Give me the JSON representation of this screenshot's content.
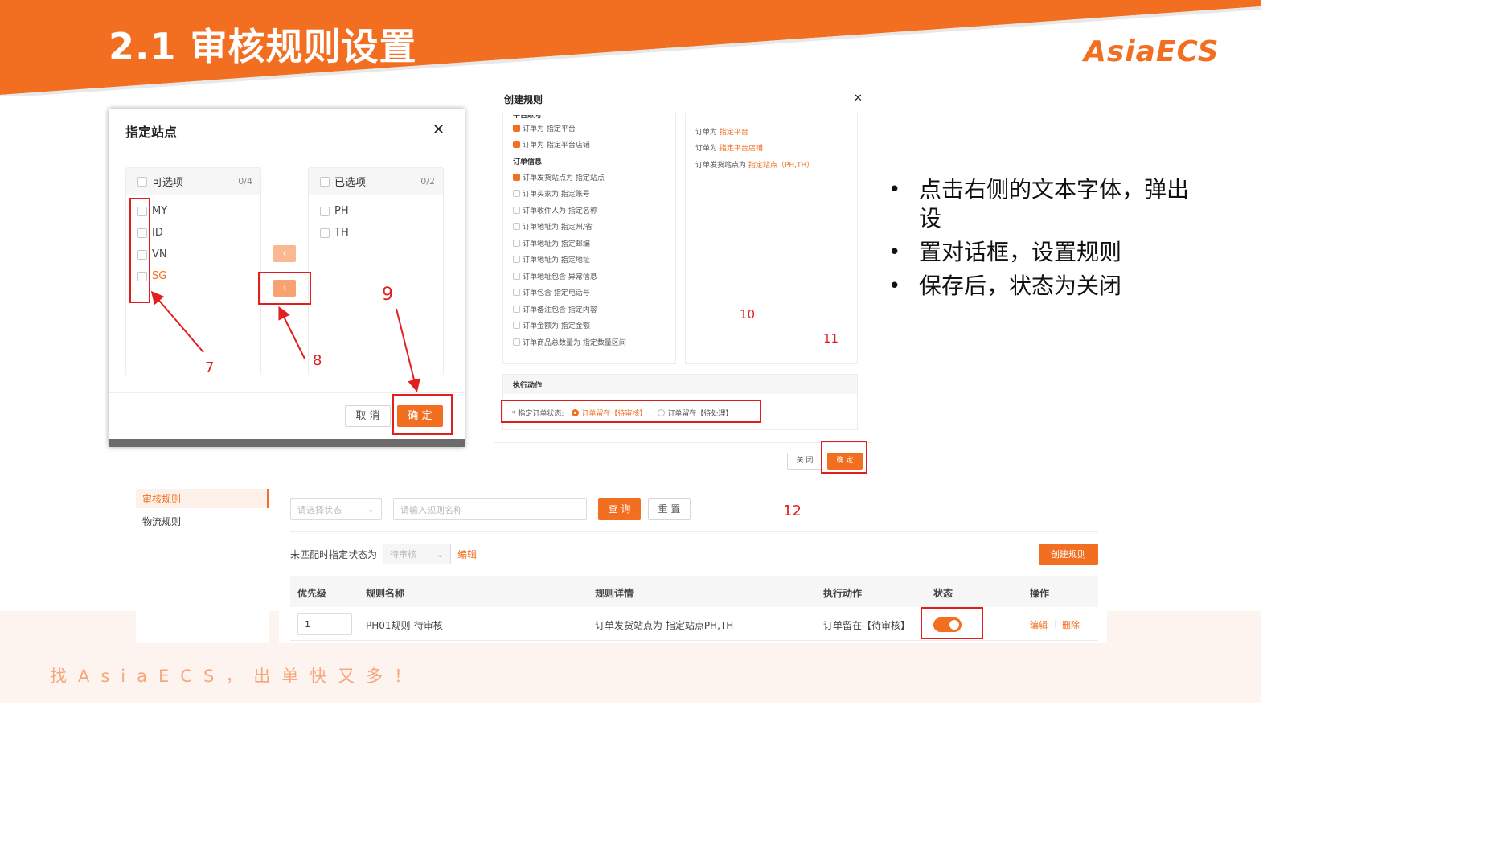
{
  "slide": {
    "title": "2.1 审核规则设置",
    "brand": "AsiaECS",
    "slogan": "找AsiaECS，出单快又多！",
    "colors": {
      "accent": "#f26f21",
      "annotation": "#e02020"
    }
  },
  "bullets": [
    "点击右侧的文本字体，弹出设",
    "置对话框，设置规则",
    "保存后，状态为关闭"
  ],
  "site_dialog": {
    "title": "指定站点",
    "close_icon": "close-icon",
    "left_panel": {
      "title": "可选项",
      "count": "0/4",
      "items": [
        "MY",
        "ID",
        "VN",
        "SG"
      ]
    },
    "right_panel": {
      "title": "已选项",
      "count": "0/2",
      "items": [
        "PH",
        "TH"
      ]
    },
    "move_left_icon": "chevron-left-icon",
    "move_right_icon": "chevron-right-icon",
    "cancel": "取 消",
    "confirm": "确 定"
  },
  "rule_dialog": {
    "title": "创建规则",
    "close_icon": "close-icon",
    "left_conditions": [
      {
        "label": "平台账号",
        "type": "section"
      },
      {
        "label": "订单为 指定平台",
        "checked": true
      },
      {
        "label": "订单为 指定平台店铺",
        "checked": true
      },
      {
        "label": "订单信息",
        "type": "section"
      },
      {
        "label": "订单发货站点为 指定站点",
        "checked": true
      },
      {
        "label": "订单买家为 指定账号",
        "checked": false
      },
      {
        "label": "订单收件人为 指定名称",
        "checked": false
      },
      {
        "label": "订单地址为 指定州/省",
        "checked": false
      },
      {
        "label": "订单地址为 指定邮编",
        "checked": false
      },
      {
        "label": "订单地址为 指定地址",
        "checked": false
      },
      {
        "label": "订单地址包含 异常信息",
        "checked": false
      },
      {
        "label": "订单包含 指定电话号",
        "checked": false
      },
      {
        "label": "订单备注包含 指定内容",
        "checked": false
      },
      {
        "label": "订单金额为 指定金额",
        "checked": false
      },
      {
        "label": "订单商品总数量为 指定数量区间",
        "checked": false
      }
    ],
    "right_summary": [
      {
        "prefix": "订单为 ",
        "link": "指定平台"
      },
      {
        "prefix": "订单为 ",
        "link": "指定平台店铺"
      },
      {
        "prefix": "订单发货站点为 ",
        "link": "指定站点（PH,TH）"
      }
    ],
    "action_section": "执行动作",
    "action_label": "* 指定订单状态:",
    "option_a": "订单留在【待审核】",
    "option_b": "订单留在【待处理】",
    "close_btn": "关 闭",
    "confirm_btn": "确 定"
  },
  "annotations": [
    "7",
    "8",
    "9",
    "10",
    "11",
    "12"
  ],
  "app": {
    "sidebar": [
      "审核规则",
      "物流规则"
    ],
    "status_placeholder": "请选择状态",
    "name_placeholder": "请输入规则名称",
    "query": "查 询",
    "reset": "重 置",
    "unmatched_label": "未匹配时指定状态为",
    "unmatched_value": "待审核",
    "edit_link": "编辑",
    "create_btn": "创建规则",
    "columns": [
      "优先级",
      "规则名称",
      "规则详情",
      "执行动作",
      "状态",
      "操作"
    ],
    "rows": [
      {
        "priority": "1",
        "name": "PH01规则-待审核",
        "detail": "订单发货站点为 指定站点PH,TH",
        "action": "订单留在【待审核】",
        "enabled": true,
        "edit": "编辑",
        "delete": "删除"
      }
    ]
  }
}
